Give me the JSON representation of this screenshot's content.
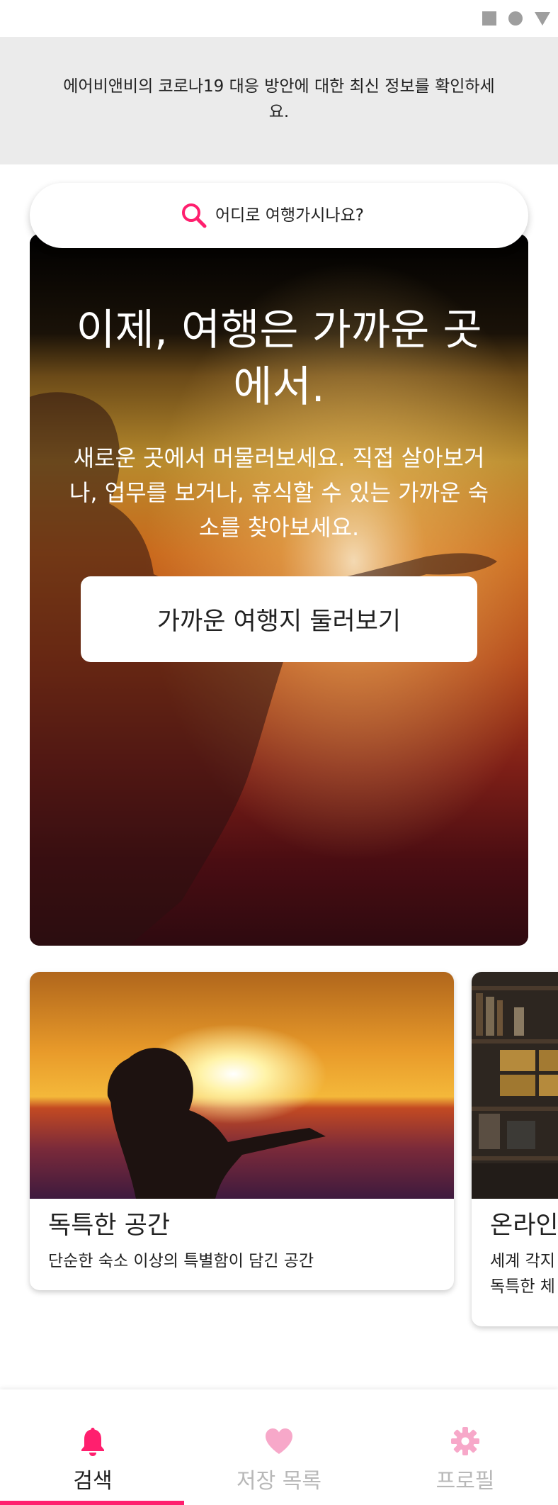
{
  "status_bar": {
    "icons": [
      "square-icon",
      "circle-icon",
      "triangle-icon"
    ]
  },
  "banner": {
    "text": "에어비앤비의 코로나19 대응 방안에 대한 최신 정보를 확인하세요."
  },
  "search": {
    "placeholder": "어디로 여행가시나요?",
    "icon": "search-icon"
  },
  "hero": {
    "title": "이제, 여행은 가까운 곳에서.",
    "subtitle": "새로운 곳에서 머물러보세요. 직접 살아보거나, 업무를 보거나, 휴식할 수 있는 가까운 숙소를 찾아보세요.",
    "button_label": "가까운 여행지 둘러보기"
  },
  "cards": [
    {
      "title": "독특한 공간",
      "subtitle": "단순한 숙소 이상의 특별함이 담긴 공간"
    },
    {
      "title": "온라인",
      "subtitle_line1": "세계 각지",
      "subtitle_line2": "독특한 체"
    }
  ],
  "bottom_nav": {
    "items": [
      {
        "label": "검색",
        "icon": "bell-icon",
        "active": true
      },
      {
        "label": "저장 목록",
        "icon": "heart-icon",
        "active": false
      },
      {
        "label": "프로필",
        "icon": "gear-icon",
        "active": false
      }
    ]
  },
  "colors": {
    "accent": "#FF1F6E",
    "accent_light": "#F7A8C9",
    "banner_bg": "#EBEBEB",
    "inactive_text": "#B8B8B8"
  }
}
